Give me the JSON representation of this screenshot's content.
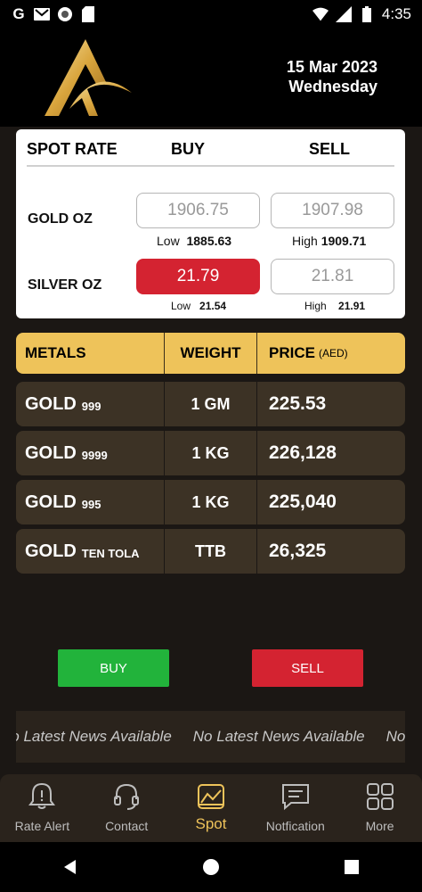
{
  "status_bar": {
    "time": "4:35",
    "left_icons": [
      "google-icon",
      "gmail-icon",
      "circle-icon",
      "sd-card-icon"
    ],
    "right_icons": [
      "wifi-icon",
      "signal-icon",
      "battery-icon"
    ]
  },
  "header": {
    "date": "15 Mar 2023",
    "weekday": "Wednesday"
  },
  "spot": {
    "title": "SPOT RATE",
    "buy_label": "BUY",
    "sell_label": "SELL",
    "gold": {
      "label": "GOLD OZ",
      "buy": "1906.75",
      "sell": "1907.98",
      "low_label": "Low",
      "low": "1885.63",
      "high_label": "High",
      "high": "1909.71"
    },
    "silver": {
      "label": "SILVER OZ",
      "buy": "21.79",
      "sell": "21.81",
      "low_label": "Low",
      "low": "21.54",
      "high_label": "High",
      "high": "21.91"
    }
  },
  "metals": {
    "head": {
      "metal": "METALS",
      "weight": "WEIGHT",
      "price": "PRICE",
      "currency": "(AED)"
    },
    "rows": [
      {
        "name": "GOLD",
        "sub": "999",
        "weight": "1 GM",
        "price": "225.53"
      },
      {
        "name": "GOLD",
        "sub": "9999",
        "weight": "1 KG",
        "price": "226,128"
      },
      {
        "name": "GOLD",
        "sub": "995",
        "weight": "1 KG",
        "price": "225,040"
      },
      {
        "name": "GOLD",
        "sub": "TEN TOLA",
        "weight": "TTB",
        "price": "26,325"
      }
    ]
  },
  "actions": {
    "buy": "BUY",
    "sell": "SELL"
  },
  "news": {
    "text": "No Latest News Available"
  },
  "nav": {
    "items": [
      {
        "label": "Rate Alert",
        "icon": "alert-icon"
      },
      {
        "label": "Contact",
        "icon": "headset-icon"
      },
      {
        "label": "Spot",
        "icon": "chart-icon"
      },
      {
        "label": "Notfication",
        "icon": "message-icon"
      },
      {
        "label": "More",
        "icon": "grid-icon"
      }
    ]
  },
  "colors": {
    "gold": "#eec35a",
    "row_bg": "#3c3225",
    "red": "#d42331",
    "green": "#22b33b"
  }
}
